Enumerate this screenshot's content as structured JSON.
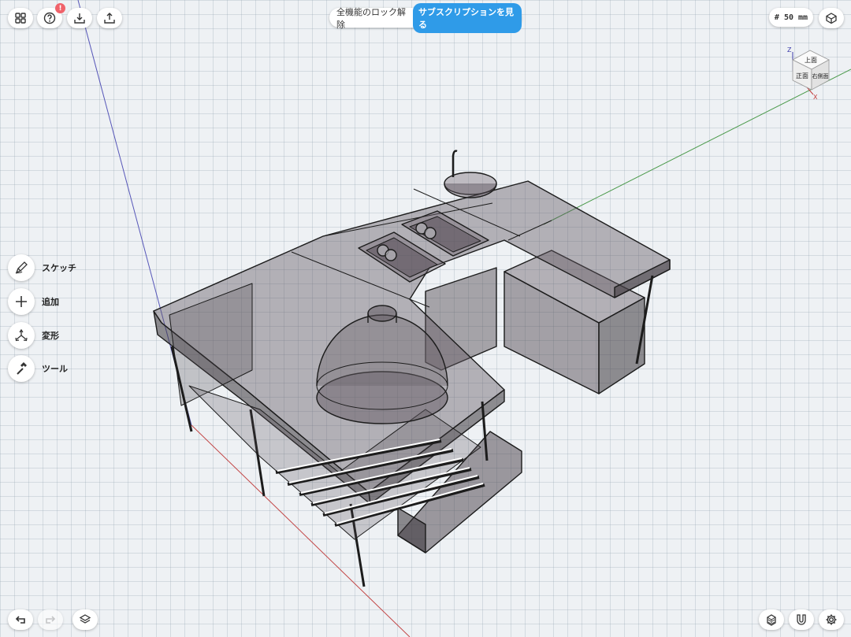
{
  "toolbar": {
    "grid_icon": "grid-icon",
    "help_icon": "help-icon",
    "help_badge": "!",
    "import_icon": "import-icon",
    "export_icon": "export-icon",
    "measure_icon": "cube-mode-icon"
  },
  "promo": {
    "text": "全機能のロック解除",
    "subscribe_label": "サブスクリプションを見る"
  },
  "grid_size": "# 50 mm",
  "tools": {
    "sketch": "スケッチ",
    "add": "追加",
    "transform": "変形",
    "tool": "ツール"
  },
  "viewcube": {
    "top": "上面",
    "front": "正面",
    "right": "右側面",
    "z": "Z",
    "x": "X"
  },
  "colors": {
    "accent": "#2f9be8",
    "badge": "#f0626a",
    "axis_x": "#c23a3a",
    "axis_y": "#3d8a3d",
    "axis_z": "#3c3caa"
  }
}
